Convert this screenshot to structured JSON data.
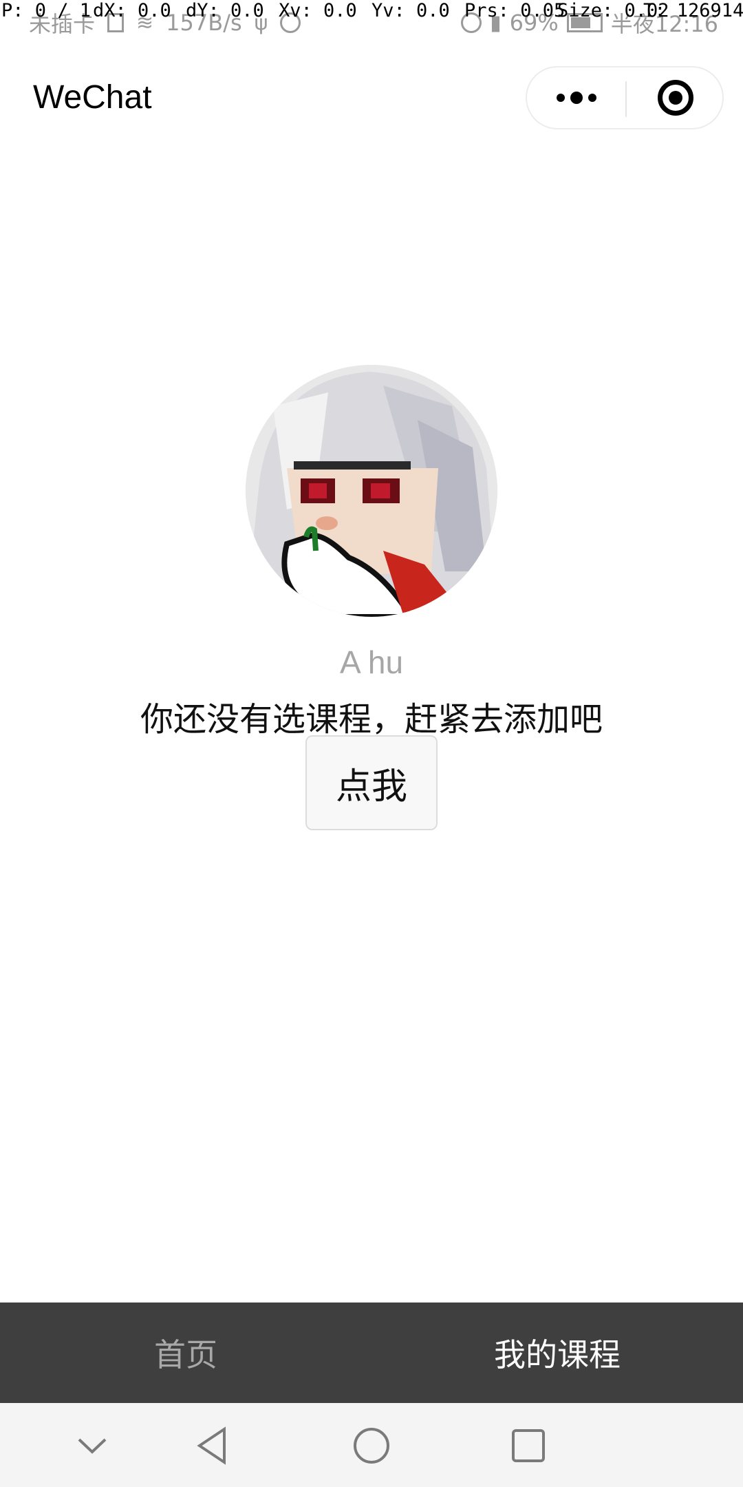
{
  "status_bar": {
    "carrier": "未插卡",
    "network_speed": "157B/s",
    "battery": "69%",
    "time": "半夜12:16"
  },
  "debug_overlay": {
    "p": "P: 0 / 1",
    "dx": "dX: 0.0",
    "dy": "dY: 0.0",
    "xv": "Xv: 0.0",
    "yv": "Yv: 0.0",
    "prs": "Prs: 0.05",
    "size": "Size: 0.02",
    "t": "T: 126914"
  },
  "header": {
    "title": "WeChat"
  },
  "profile": {
    "username": "A hu",
    "empty_message": "你还没有选课程，赶紧去添加吧",
    "click_button": "点我"
  },
  "tabbar": {
    "home": "首页",
    "my_courses": "我的课程",
    "active": "my_courses"
  },
  "colors": {
    "tabbar_bg": "#3f3f3f",
    "tab_inactive": "#a8a8a8",
    "tab_active": "#ffffff"
  }
}
